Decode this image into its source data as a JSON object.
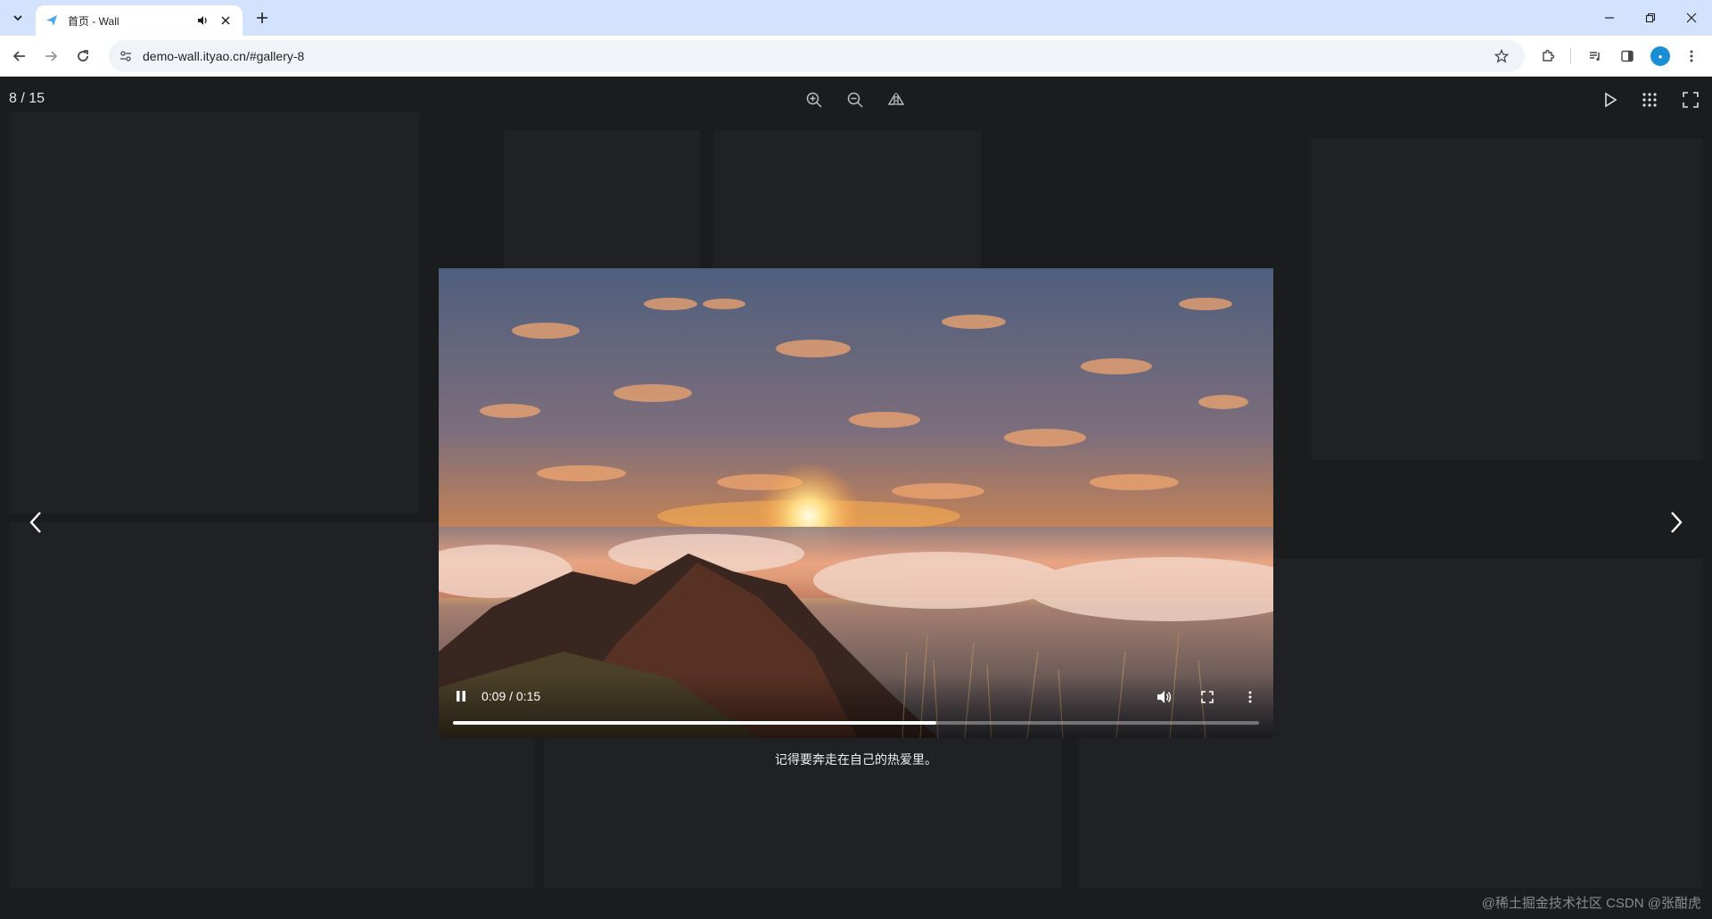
{
  "browser": {
    "tab": {
      "title": "首页 - Wall"
    },
    "url": "demo-wall.ityao.cn/#gallery-8"
  },
  "viewer": {
    "counter": "8 / 15",
    "caption": "记得要奔走在自己的热爱里。",
    "video": {
      "time": "0:09 / 0:15",
      "progress_percent": 60
    },
    "watermark": "@稀土掘金技术社区 CSDN @张酣虎"
  },
  "icons": {
    "tab_menu": "chevron-down-icon",
    "favicon": "paper-plane-icon",
    "audio": "speaker-icon",
    "close": "close-icon",
    "new_tab": "plus-icon",
    "minimize": "minimize-icon",
    "restore": "restore-icon",
    "close_window": "close-icon",
    "back": "arrow-left-icon",
    "forward": "arrow-right-icon",
    "reload": "reload-icon",
    "site_info": "tune-icon",
    "bookmark": "star-icon",
    "extensions": "puzzle-icon",
    "media": "media-queue-icon",
    "side_panel": "side-panel-icon",
    "menu": "kebab-icon",
    "zoom_in": "zoom-in-icon",
    "zoom_out": "zoom-out-icon",
    "flip": "flip-horizontal-icon",
    "slideshow": "play-icon",
    "grid": "grid-icon",
    "fullscreen": "fullscreen-icon",
    "prev": "chevron-left-icon",
    "next": "chevron-right-icon",
    "pause": "pause-icon",
    "volume": "volume-icon",
    "video_fullscreen": "fullscreen-icon",
    "video_more": "kebab-icon"
  }
}
